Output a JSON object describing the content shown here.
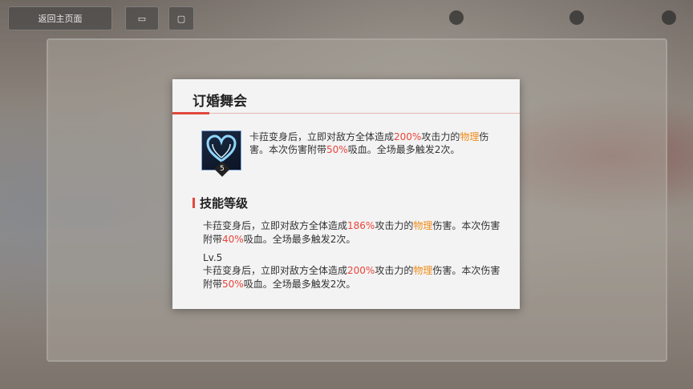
{
  "topbar": {
    "back_label": "返回主页面",
    "mid_label": "",
    "resources": [
      "",
      ""
    ]
  },
  "popup": {
    "title": "订婚舞会",
    "skill": {
      "level": "5",
      "desc": [
        {
          "t": "卡菈变身后，立即对敌方全体造成"
        },
        {
          "t": "200%",
          "c": "red"
        },
        {
          "t": "攻击力的"
        },
        {
          "t": "物理",
          "c": "orange"
        },
        {
          "t": "伤害。本次伤害附带"
        },
        {
          "t": "50%",
          "c": "red"
        },
        {
          "t": "吸血。全场最多触发2次。"
        }
      ]
    },
    "section_title": "技能等级",
    "levels": [
      {
        "label": "",
        "text": [
          {
            "t": "卡菈变身后，立即对敌方全体造成"
          },
          {
            "t": "186%",
            "c": "red"
          },
          {
            "t": "攻击力的"
          },
          {
            "t": "物理",
            "c": "orange"
          },
          {
            "t": "伤害。本次伤害附带"
          },
          {
            "t": "40%",
            "c": "red"
          },
          {
            "t": "吸血。全场最多触发2次。"
          }
        ]
      },
      {
        "label": "Lv.5",
        "text": [
          {
            "t": "卡菈变身后，立即对敌方全体造成"
          },
          {
            "t": "200%",
            "c": "red"
          },
          {
            "t": "攻击力的"
          },
          {
            "t": "物理",
            "c": "orange"
          },
          {
            "t": "伤害。本次伤害附带"
          },
          {
            "t": "50%",
            "c": "red"
          },
          {
            "t": "吸血。全场最多触发2次。"
          }
        ]
      }
    ]
  },
  "colors": {
    "accent": "#e0473d",
    "highlight_red": "#e8453c",
    "highlight_orange": "#f08c1a"
  }
}
